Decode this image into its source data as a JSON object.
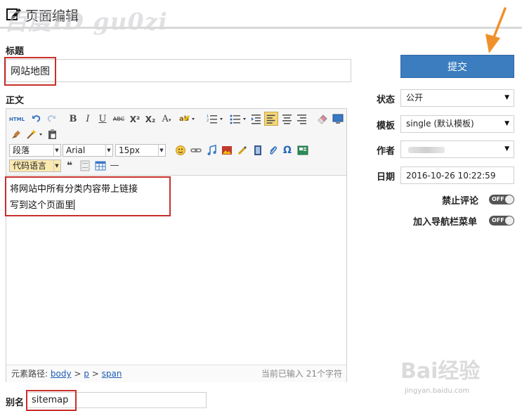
{
  "header": {
    "title": "页面编辑",
    "icon": "edit-icon",
    "watermark": "百度ID gu0zi"
  },
  "title_section": {
    "label": "标题",
    "value": "网站地图"
  },
  "body_section": {
    "label": "正文",
    "toolbar": {
      "row1": [
        "html-source-icon",
        "undo-icon",
        "redo-icon",
        "bold-icon",
        "italic-icon",
        "underline-icon",
        "strikethrough-icon",
        "superscript-icon",
        "subscript-icon",
        "font-color-icon",
        "highlight-icon",
        "ordered-list-icon",
        "unordered-list-icon",
        "indent-icon",
        "align-left-icon",
        "align-center-icon",
        "align-right-icon",
        "eraser-icon",
        "preview-icon",
        "format-brush-icon",
        "magic-icon",
        "paste-text-icon"
      ],
      "paragraph_select": "段落",
      "font_select": "Arial",
      "size_select": "15px",
      "code_select": "代码语言",
      "glyphs": {
        "html": "HTML",
        "bold": "B",
        "italic": "I",
        "underline": "U",
        "strike": "ABC",
        "sup": "X²",
        "sub": "X₂",
        "font_color": "A",
        "omega": "Ω",
        "quote": "❝",
        "hr": "—"
      }
    },
    "content_lines": [
      "将网站中所有分类内容带上链接",
      "写到这个页面里"
    ],
    "status": {
      "path_label": "元素路径:",
      "path": [
        "body",
        "p",
        "span"
      ],
      "separator": ">",
      "count": "当前已输入 21个字符"
    }
  },
  "slug": {
    "label": "别名",
    "value": "sitemap"
  },
  "sidebar": {
    "submit_label": "提交",
    "status": {
      "label": "状态",
      "value": "公开"
    },
    "template": {
      "label": "模板",
      "value": "single (默认模板)"
    },
    "author": {
      "label": "作者",
      "value": ""
    },
    "date": {
      "label": "日期",
      "value": "2016-10-26 10:22:59"
    },
    "disable_comments": {
      "label": "禁止评论",
      "state": "OFF"
    },
    "add_to_nav": {
      "label": "加入导航栏菜单",
      "state": "OFF"
    }
  },
  "colors": {
    "accent": "#3b7dbf",
    "highlight_box": "#c9302c",
    "arrow": "#f0902a"
  },
  "watermark_bottom": {
    "brand": "Bai经验",
    "url": "jingyan.baidu.com"
  }
}
